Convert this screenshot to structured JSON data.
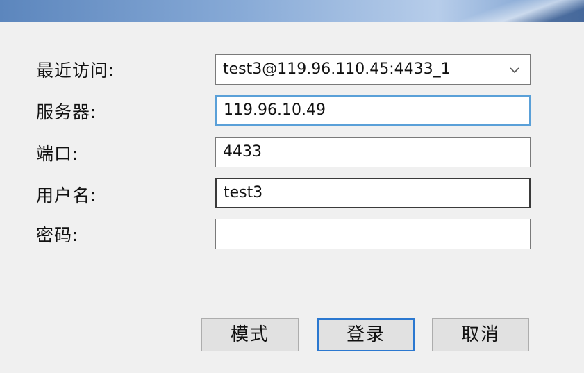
{
  "form": {
    "recent_label": "最近访问:",
    "recent_value": "test3@119.96.110.45:4433_1",
    "server_label": "服务器:",
    "server_value": "119.96.10.49",
    "port_label": "端口:",
    "port_value": "4433",
    "username_label": "用户名:",
    "username_value": "test3",
    "password_label": "密码:",
    "password_value": ""
  },
  "buttons": {
    "mode": "模式",
    "login": "登录",
    "cancel": "取消"
  },
  "colors": {
    "focus_border": "#5aa0d8",
    "default_button_border": "#2b78d0",
    "background": "#f0f0f0"
  }
}
